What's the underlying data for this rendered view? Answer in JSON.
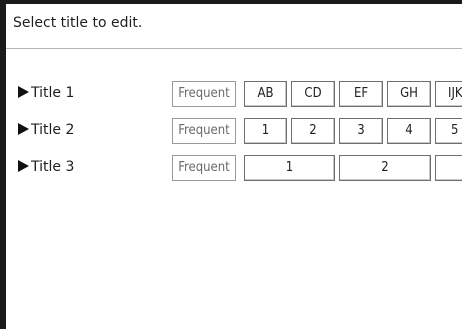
{
  "header": {
    "instruction": "Select title to edit."
  },
  "rows": [
    {
      "label": "Title 1",
      "frequent": "Frequent",
      "keys": [
        "AB",
        "CD",
        "EF",
        "GH",
        "IJK"
      ]
    },
    {
      "label": "Title 2",
      "frequent": "Frequent",
      "keys": [
        "1",
        "2",
        "3",
        "4",
        "5"
      ]
    },
    {
      "label": "Title 3",
      "frequent": "Frequent",
      "keys": [
        "1",
        "2",
        ""
      ]
    }
  ],
  "icons": {
    "row_marker": "right-triangle-icon"
  }
}
